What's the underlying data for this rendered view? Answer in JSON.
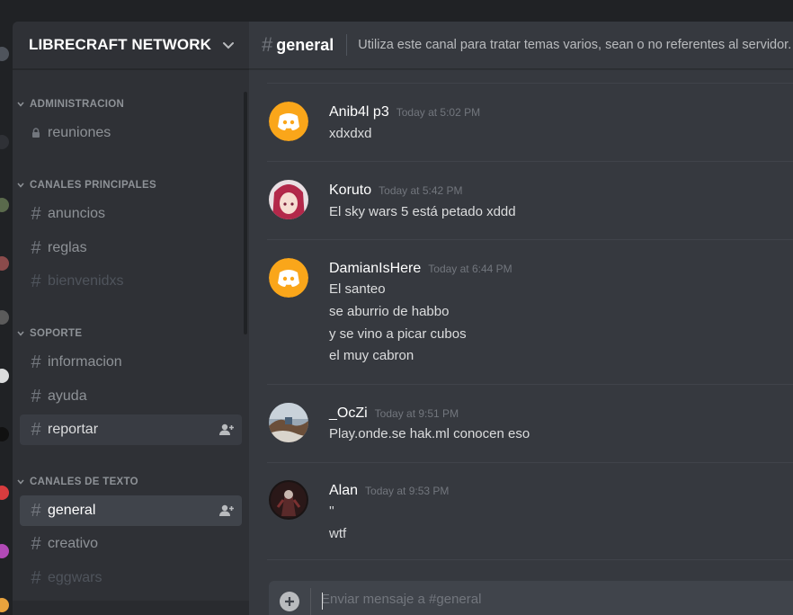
{
  "server": {
    "name": "LIBRECRAFT NETWORK"
  },
  "sidebar": {
    "categories": [
      {
        "name": "ADMINISTRACION",
        "channels": [
          {
            "name": "reuniones",
            "icon": "lock-icon",
            "state": "normal"
          }
        ]
      },
      {
        "name": "CANALES PRINCIPALES",
        "channels": [
          {
            "name": "anuncios",
            "icon": "hash-icon",
            "state": "normal"
          },
          {
            "name": "reglas",
            "icon": "hash-icon",
            "state": "normal"
          },
          {
            "name": "bienvenidxs",
            "icon": "hash-icon",
            "state": "muted"
          }
        ]
      },
      {
        "name": "SOPORTE",
        "channels": [
          {
            "name": "informacion",
            "icon": "hash-icon",
            "state": "normal"
          },
          {
            "name": "ayuda",
            "icon": "hash-icon",
            "state": "normal"
          },
          {
            "name": "reportar",
            "icon": "hash-icon",
            "state": "hover"
          }
        ]
      },
      {
        "name": "CANALES DE TEXTO",
        "channels": [
          {
            "name": "general",
            "icon": "hash-icon",
            "state": "active"
          },
          {
            "name": "creativo",
            "icon": "hash-icon",
            "state": "normal"
          },
          {
            "name": "eggwars",
            "icon": "hash-icon",
            "state": "muted"
          }
        ]
      }
    ]
  },
  "channel_header": {
    "hash": "#",
    "name": "general",
    "topic": "Utiliza este canal para tratar temas varios, sean o no referentes al servidor."
  },
  "messages": [
    {
      "author": "Anib4l p3",
      "timestamp": "Today at 5:02 PM",
      "avatar": "discord-default-avatar",
      "lines": [
        "xdxdxd"
      ]
    },
    {
      "author": "Koruto",
      "timestamp": "Today at 5:42 PM",
      "avatar": "anime-girl-avatar",
      "lines": [
        "El sky wars 5 está petado xddd"
      ]
    },
    {
      "author": "DamianIsHere",
      "timestamp": "Today at 6:44 PM",
      "avatar": "discord-default-avatar",
      "lines": [
        "El santeo",
        "se aburrio de habbo",
        "y se vino a picar cubos",
        "el muy cabron"
      ]
    },
    {
      "author": "_OcZi",
      "timestamp": "Today at 9:51 PM",
      "avatar": "landscape-avatar",
      "lines": [
        "Play.onde.se hak.ml conocen eso"
      ]
    },
    {
      "author": "Alan",
      "timestamp": "Today at 9:53 PM",
      "avatar": "dark-figure-avatar",
      "lines": [
        "''",
        "wtf"
      ]
    }
  ],
  "composer": {
    "placeholder": "Enviar mensaje a #general"
  },
  "colors": {
    "sidebar_bg": "#2f3136",
    "chat_bg": "#36393f",
    "app_bg": "#202225",
    "active_channel": "#40444b",
    "discord_default_avatar": "#faa61a"
  }
}
